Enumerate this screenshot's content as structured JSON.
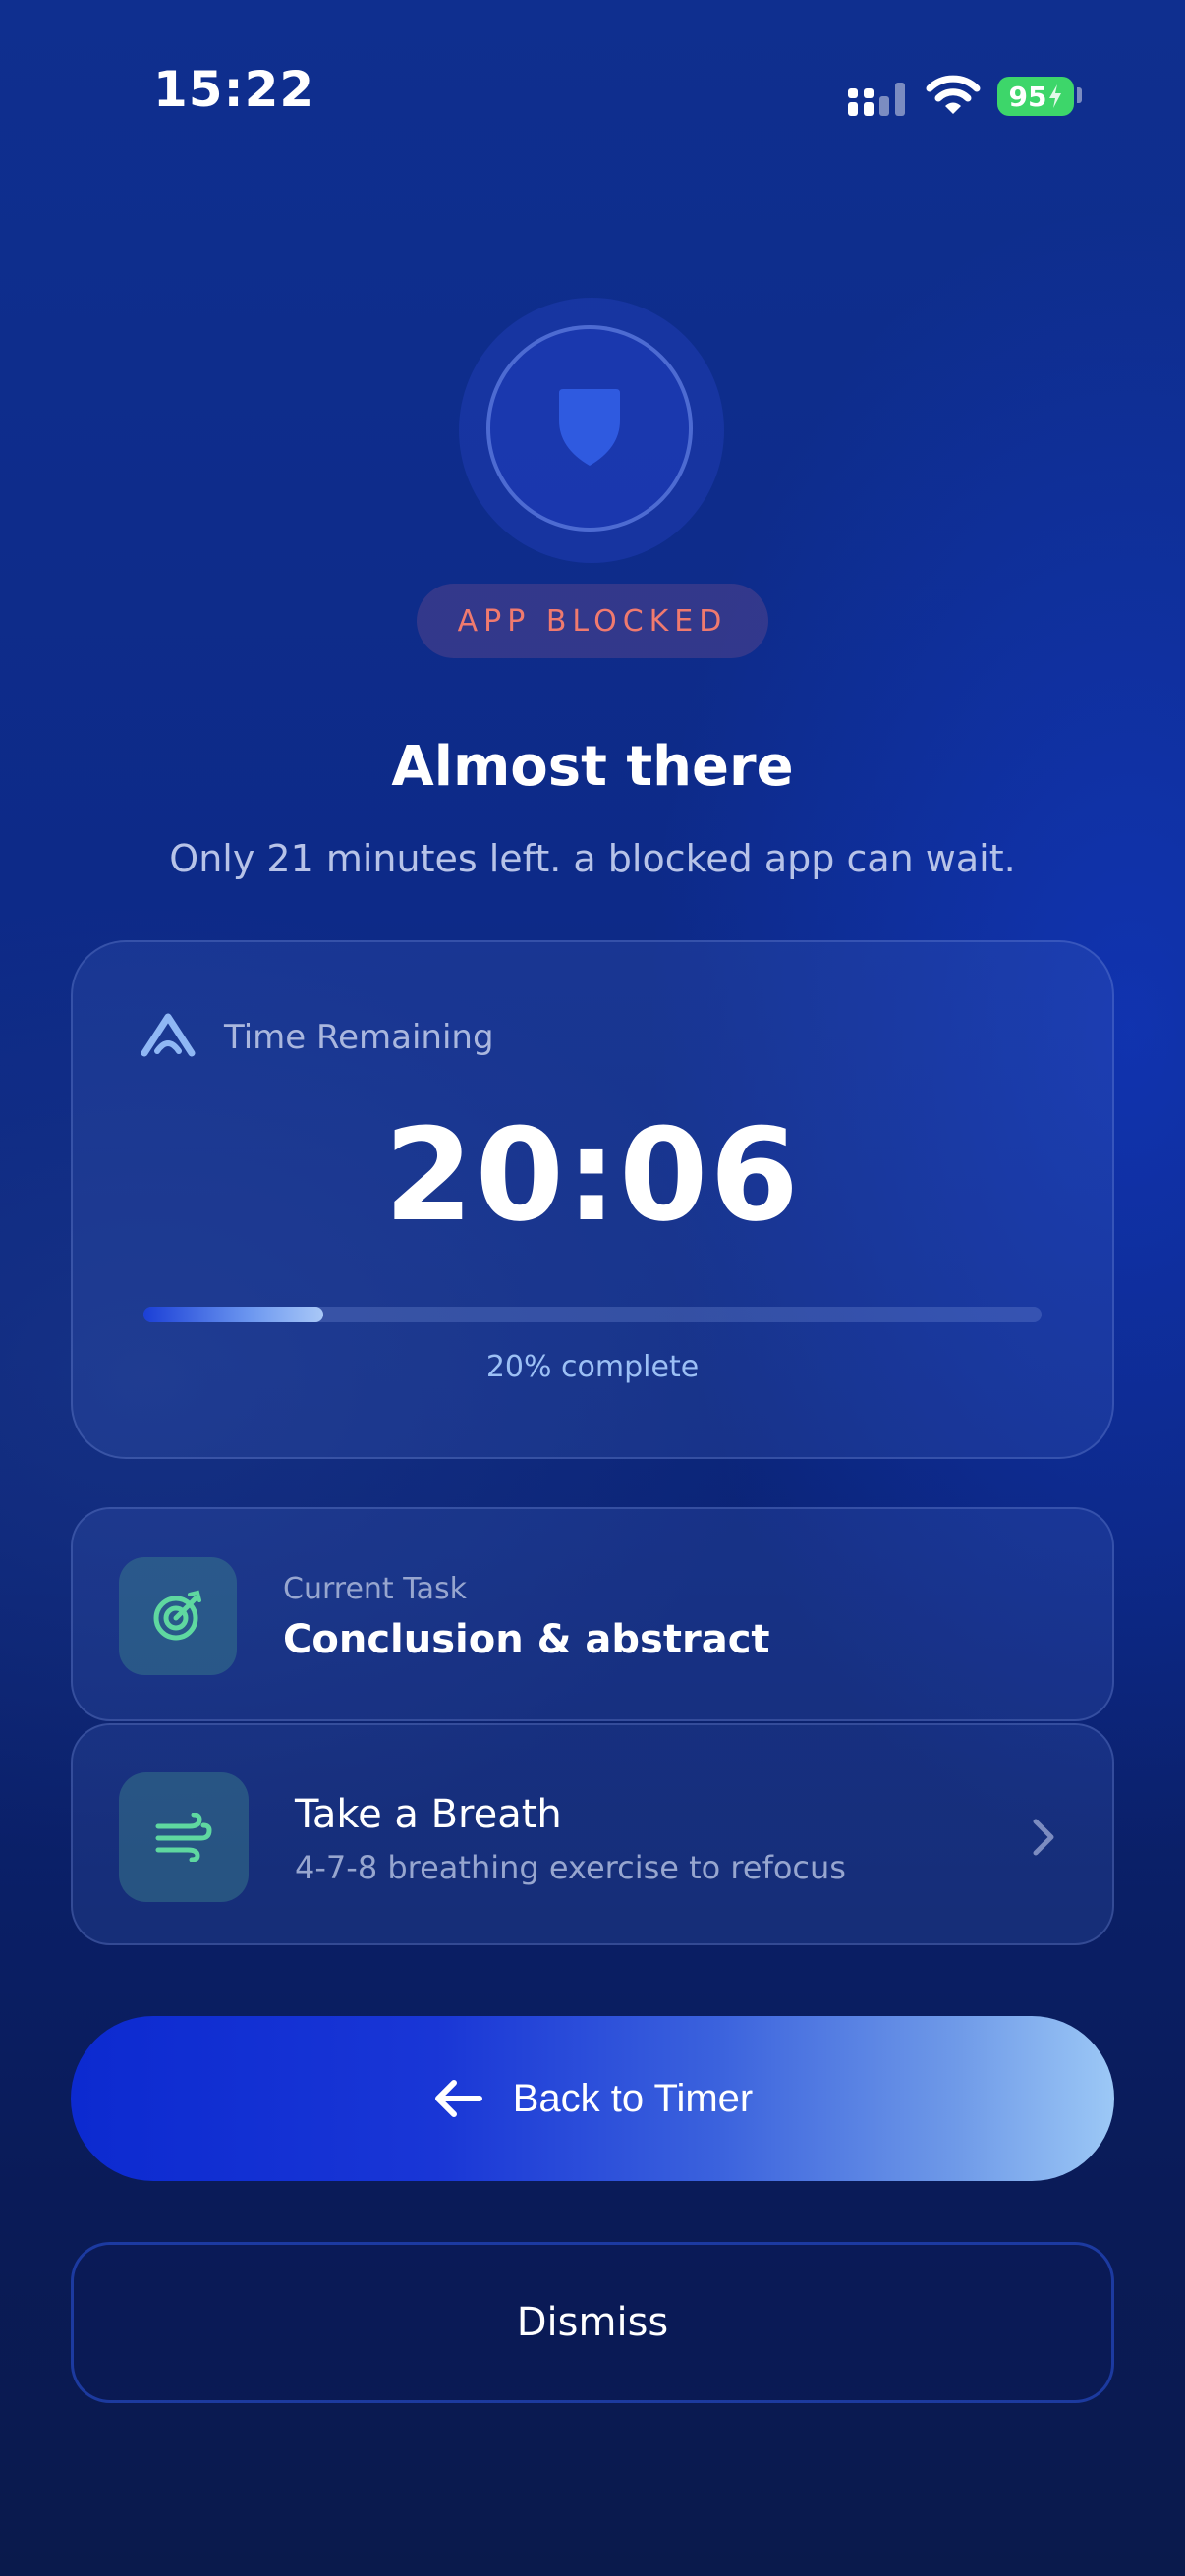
{
  "status_bar": {
    "time": "15:22",
    "battery": "95",
    "icons": [
      "signal-icon",
      "wifi-icon",
      "battery-icon"
    ]
  },
  "hero": {
    "badge": "APP BLOCKED",
    "title": "Almost there",
    "subtitle": "Only 21 minutes left. a blocked app can wait.",
    "icon": "shield-icon"
  },
  "timer_card": {
    "label": "Time Remaining",
    "value": "20:06",
    "progress_percent": 20,
    "progress_text": "20% complete",
    "icon": "app-logo-icon"
  },
  "task_card": {
    "label": "Current Task",
    "value": "Conclusion & abstract",
    "icon": "target-icon"
  },
  "breath_card": {
    "title": "Take a Breath",
    "subtitle": "4-7-8 breathing exercise to refocus",
    "icon": "wind-icon"
  },
  "actions": {
    "back_label": "Back to Timer",
    "dismiss_label": "Dismiss"
  },
  "colors": {
    "badge_text": "#f07a6e",
    "accent_green": "#5fd8a0",
    "battery_green": "#3dd66a",
    "progress_text": "#9cc0f5"
  }
}
